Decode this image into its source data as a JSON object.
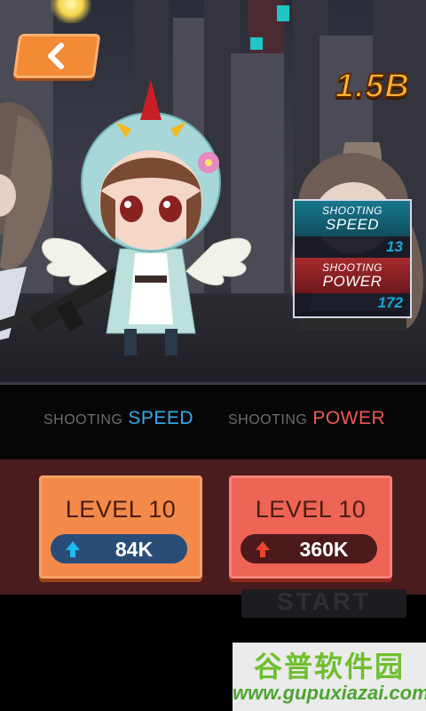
{
  "game": {
    "money": "1.5B",
    "back_icon": "chevron-left-icon"
  },
  "stat_panel": {
    "speed": {
      "label_top": "SHOOTING",
      "label_main": "SPEED",
      "value": "13",
      "color": "#1aa8d8"
    },
    "power": {
      "label_top": "SHOOTING",
      "label_main": "POWER",
      "value": "172",
      "color": "#d83838"
    }
  },
  "tabs": {
    "speed": {
      "prefix": "SHOOTING",
      "label": "SPEED"
    },
    "power": {
      "prefix": "SHOOTING",
      "label": "POWER"
    }
  },
  "upgrades": {
    "speed": {
      "level": "LEVEL 10",
      "cost": "84K",
      "icon": "speed-arrow-icon"
    },
    "power": {
      "level": "LEVEL 10",
      "cost": "360K",
      "icon": "power-arrow-icon"
    }
  },
  "start_button": {
    "label": "START"
  },
  "watermark": {
    "title": "谷普软件园",
    "url": "www.gupuxiazai.com"
  }
}
